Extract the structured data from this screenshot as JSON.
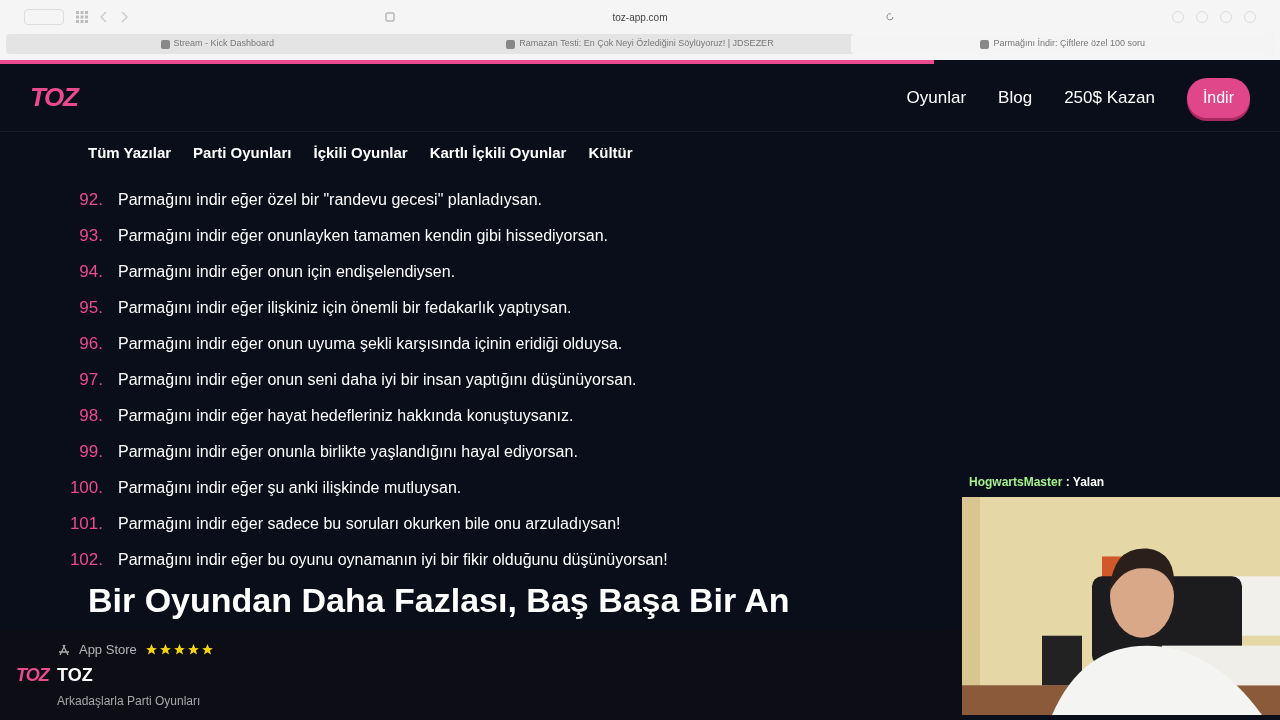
{
  "browser": {
    "address": "toz-app.com",
    "tabs": [
      {
        "title": "Stream - Kick Dashboard",
        "selected": false
      },
      {
        "title": "Ramazan Testi: En Çok Neyi Özlediğini Söylüyoruz! | JDSEZER",
        "selected": false
      },
      {
        "title": "Parmağını İndir: Çiftlere özel 100 soru",
        "selected": true
      }
    ]
  },
  "reading_progress": {
    "level": 0.73
  },
  "header": {
    "logo": "TOZ",
    "nav": [
      "Oyunlar",
      "Blog",
      "250$ Kazan"
    ],
    "cta": "İndir"
  },
  "categories": [
    "Tüm Yazılar",
    "Parti Oyunları",
    "İçkili Oyunlar",
    "Kartlı İçkili Oyunlar",
    "Kültür"
  ],
  "list": [
    {
      "number": "92.",
      "text": "Parmağını indir eğer özel bir \"randevu gecesi\" planladıysan."
    },
    {
      "number": "93.",
      "text": "Parmağını indir eğer onunlayken tamamen kendin gibi hissediyorsan."
    },
    {
      "number": "94.",
      "text": "Parmağını indir eğer onun için endişelendiysen."
    },
    {
      "number": "95.",
      "text": "Parmağını indir eğer ilişkiniz için önemli bir fedakarlık yaptıysan."
    },
    {
      "number": "96.",
      "text": "Parmağını indir eğer onun uyuma şekli karşısında içinin eridiği olduysa."
    },
    {
      "number": "97.",
      "text": "Parmağını indir eğer onun seni daha iyi bir insan yaptığını düşünüyorsan."
    },
    {
      "number": "98.",
      "text": "Parmağını indir eğer hayat hedefleriniz hakkında konuştuysanız."
    },
    {
      "number": "99.",
      "text": "Parmağını indir eğer onunla birlikte yaşlandığını hayal ediyorsan."
    },
    {
      "number": "100.",
      "text": "Parmağını indir eğer şu anki ilişkinde mutluysan."
    },
    {
      "number": "101.",
      "text": "Parmağını indir eğer sadece bu soruları okurken bile onu arzuladıysan!"
    },
    {
      "number": "102.",
      "text": "Parmağını indir eğer bu oyunu oynamanın iyi bir fikir olduğunu düşünüyorsan!"
    }
  ],
  "heading": "Bir Oyundan Daha Fazlası, Baş Başa Bir An",
  "app_banner": {
    "logo": "TOZ",
    "store": "App Store",
    "stars": 5,
    "name": "TOZ",
    "subtitle": "Arkadaşlarla Parti Oyunları"
  },
  "chat": {
    "user": "HogwartsMaster",
    "separator": ":",
    "message": "Yalan"
  }
}
